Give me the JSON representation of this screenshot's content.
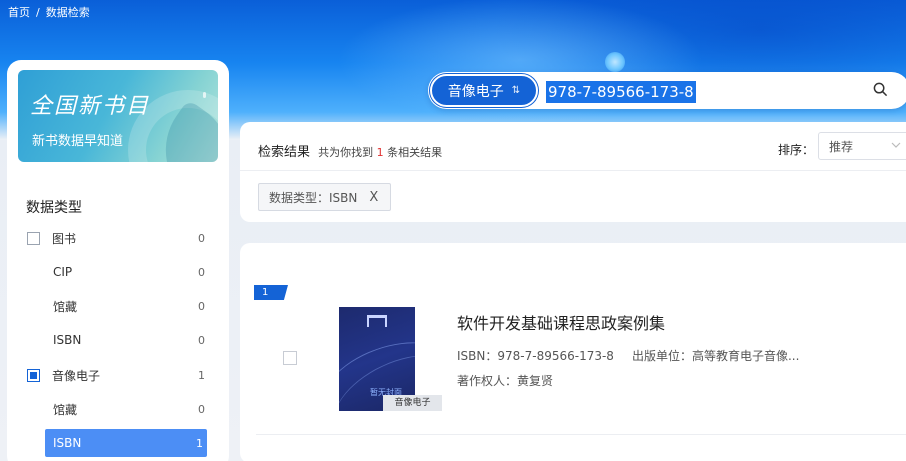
{
  "breadcrumb": {
    "home": "首页",
    "sep": "/",
    "current": "数据检索"
  },
  "search": {
    "type_label": "音像电子",
    "type_icon": "swap-icon",
    "value": "978-7-89566-173-8",
    "icon": "search-icon"
  },
  "promo": {
    "logo": "全国新书目",
    "subtitle": "新书数据早知道"
  },
  "filters": {
    "heading": "数据类型",
    "items": [
      {
        "label": "图书",
        "count": "0",
        "checkbox": true,
        "checked": false
      },
      {
        "label": "CIP",
        "count": "0"
      },
      {
        "label": "馆藏",
        "count": "0"
      },
      {
        "label": "ISBN",
        "count": "0"
      },
      {
        "label": "音像电子",
        "count": "1",
        "checkbox": true,
        "checked": true
      },
      {
        "label": "馆藏",
        "count": "0"
      },
      {
        "label": "ISBN",
        "count": "1",
        "active": true
      }
    ]
  },
  "results": {
    "title": "检索结果",
    "summary_prefix": "共为你找到",
    "count": "1",
    "summary_suffix": "条相关结果",
    "sort_label": "排序：",
    "sort_value": "推荐",
    "tag": "数据类型：ISBN",
    "tag_close": "X"
  },
  "result_item": {
    "index": "1",
    "cover_text": "暂无封面",
    "cover_tag": "音像电子",
    "title": "软件开发基础课程思政案例集",
    "isbn": "ISBN：978-7-89566-173-8",
    "publisher": "出版单位：高等教育电子音像...",
    "author": "著作权人：黄复贤"
  },
  "colors": {
    "primary": "#1463d6",
    "active_filter": "#4c8ef5",
    "count_highlight": "#e03030"
  }
}
